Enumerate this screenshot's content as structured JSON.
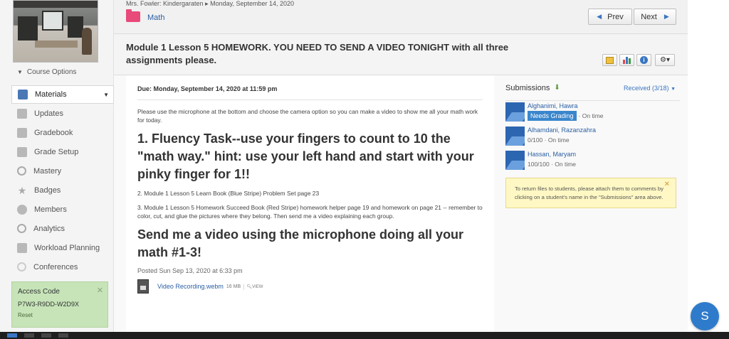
{
  "breadcrumb": {
    "teacher": "Mrs. Fowler: Kindergaraten",
    "separator": "▸",
    "date": "Monday, September 14, 2020"
  },
  "folder": {
    "name": "Math",
    "color": "#e84a7a"
  },
  "nav_buttons": {
    "prev": "Prev",
    "next": "Next"
  },
  "assignment": {
    "title": "Module 1 Lesson 5 HOMEWORK. YOU NEED TO SEND A VIDEO TONIGHT with all three assignments please.",
    "due": "Due: Monday, September 14, 2020 at 11:59 pm",
    "intro": "Please use the microphone at the bottom and choose the camera option so you can make a video to show me all your math work for today.",
    "task1": "1.  Fluency Task--use your fingers to count to 10 the \"math way.\"  hint: use your left hand and start with your pinky finger for 1!!",
    "task2": "2.  Module 1 Lesson 5 Learn Book (Blue Stripe) Problem Set page 23",
    "task3": "3.   Module 1 Lesson 5 Homework Succeed Book (Red Stripe) homework helper page 19 and homework on page  21 -- remember to color, cut, and glue the pictures where they belong.  Then send me a video explaining each group.",
    "closing": "Send me a video using the microphone doing all your math #1-3!",
    "posted": "Posted Sun Sep 13, 2020 at 6:33 pm",
    "attachment": {
      "name": "Video Recording.webm",
      "size": "16 MB",
      "action": "VIEW"
    }
  },
  "sidebar": {
    "course_options": "Course Options",
    "items": [
      {
        "label": "Materials",
        "icon": "materials-icon",
        "active": true
      },
      {
        "label": "Updates",
        "icon": "updates-icon"
      },
      {
        "label": "Gradebook",
        "icon": "gradebook-icon"
      },
      {
        "label": "Grade Setup",
        "icon": "grade-setup-icon"
      },
      {
        "label": "Mastery",
        "icon": "mastery-icon"
      },
      {
        "label": "Badges",
        "icon": "badges-icon"
      },
      {
        "label": "Members",
        "icon": "members-icon"
      },
      {
        "label": "Analytics",
        "icon": "analytics-icon"
      },
      {
        "label": "Workload Planning",
        "icon": "workload-icon"
      },
      {
        "label": "Conferences",
        "icon": "conferences-icon"
      }
    ],
    "access_code": {
      "title": "Access Code",
      "code": "P7W3-R9DD-W2D9X",
      "reset": "Reset"
    }
  },
  "submissions": {
    "title": "Submissions",
    "received": "Received (3/18)",
    "rows": [
      {
        "name": "Alghanimi, Hawra",
        "badge": "Needs Grading",
        "status": "· On time"
      },
      {
        "name": "Alhamdani, Razanzahra",
        "badge": "",
        "status": "0/100 · On time"
      },
      {
        "name": "Hassan, Maryam",
        "badge": "",
        "status": "100/100 · On time"
      }
    ],
    "notice": "To return files to students, please attach them to comments by clicking on a student's name in the \"Submissions\" area above."
  },
  "help_button": "S",
  "colors": {
    "accent": "#2f7bcb",
    "link": "#2b5fa3",
    "access_bg": "#c6e4b8",
    "notice_bg": "#fff8c4"
  }
}
